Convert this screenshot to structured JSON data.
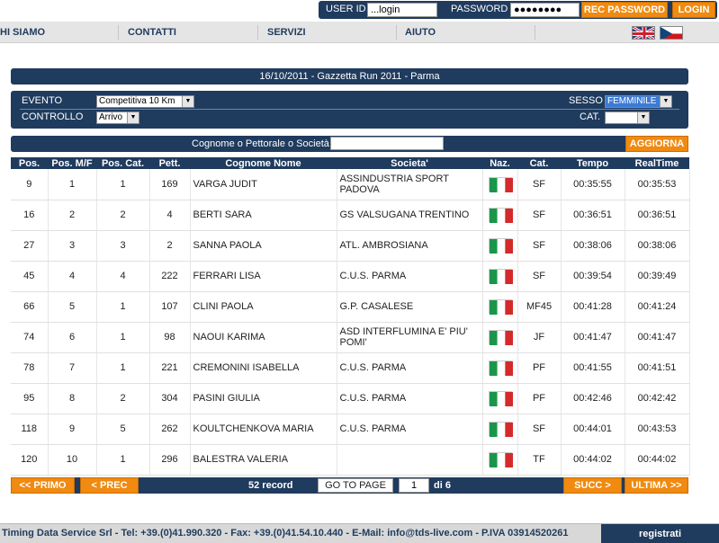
{
  "login": {
    "userid_label": "USER ID",
    "userid_value": "...login",
    "password_label": "PASSWORD",
    "password_value": "●●●●●●●●",
    "recpassword_label": "REC PASSWORD",
    "login_label": "LOGIN"
  },
  "nav": {
    "items": [
      "HI SIAMO",
      "CONTATTI",
      "SERVIZI",
      "AIUTO"
    ],
    "flags": [
      "uk-flag-icon",
      "cz-flag-icon"
    ]
  },
  "event_title": "16/10/2011 - Gazzetta Run 2011 - Parma",
  "filters": {
    "evento_label": "EVENTO",
    "evento_value": "Competitiva 10 Km",
    "controllo_label": "CONTROLLO",
    "controllo_value": "Arrivo",
    "sesso_label": "SESSO",
    "sesso_value": "FEMMINILE",
    "cat_label": "CAT.",
    "cat_value": ""
  },
  "search": {
    "label": "Cognome o Pettorale o Società",
    "value": "",
    "button": "AGGIORNA"
  },
  "table": {
    "columns": [
      "Pos.",
      "Pos. M/F",
      "Pos. Cat.",
      "Pett.",
      "Cognome Nome",
      "Societa'",
      "Naz.",
      "Cat.",
      "Tempo",
      "RealTime"
    ],
    "rows": [
      [
        "9",
        "1",
        "1",
        "169",
        "VARGA JUDIT",
        "ASSINDUSTRIA SPORT PADOVA",
        "ITA",
        "SF",
        "00:35:55",
        "00:35:53"
      ],
      [
        "16",
        "2",
        "2",
        "4",
        "BERTI SARA",
        "GS VALSUGANA TRENTINO",
        "ITA",
        "SF",
        "00:36:51",
        "00:36:51"
      ],
      [
        "27",
        "3",
        "3",
        "2",
        "SANNA PAOLA",
        "ATL. AMBROSIANA",
        "ITA",
        "SF",
        "00:38:06",
        "00:38:06"
      ],
      [
        "45",
        "4",
        "4",
        "222",
        "FERRARI LISA",
        "C.U.S. PARMA",
        "ITA",
        "SF",
        "00:39:54",
        "00:39:49"
      ],
      [
        "66",
        "5",
        "1",
        "107",
        "CLINI PAOLA",
        "G.P. CASALESE",
        "ITA",
        "MF45",
        "00:41:28",
        "00:41:24"
      ],
      [
        "74",
        "6",
        "1",
        "98",
        "NAOUI KARIMA",
        "ASD INTERFLUMINA E' PIU' POMI'",
        "ITA",
        "JF",
        "00:41:47",
        "00:41:47"
      ],
      [
        "78",
        "7",
        "1",
        "221",
        "CREMONINI ISABELLA",
        "C.U.S. PARMA",
        "ITA",
        "PF",
        "00:41:55",
        "00:41:51"
      ],
      [
        "95",
        "8",
        "2",
        "304",
        "PASINI GIULIA",
        "C.U.S. PARMA",
        "ITA",
        "PF",
        "00:42:46",
        "00:42:42"
      ],
      [
        "118",
        "9",
        "5",
        "262",
        "KOULTCHENKOVA MARIA",
        "C.U.S. PARMA",
        "ITA",
        "SF",
        "00:44:01",
        "00:43:53"
      ],
      [
        "120",
        "10",
        "1",
        "296",
        "BALESTRA VALERIA",
        "",
        "ITA",
        "TF",
        "00:44:02",
        "00:44:02"
      ]
    ]
  },
  "pager": {
    "first": "<< PRIMO",
    "prev": "< PREC",
    "records": "52 record",
    "goto": "GO TO PAGE",
    "page": "1",
    "of": "di 6",
    "next": "SUCC >",
    "last": "ULTIMA >>"
  },
  "footer": {
    "text": "Timing Data Service Srl - Tel: +39.(0)41.990.320 - Fax: +39.(0)41.54.10.440 - E-Mail: info@tds-live.com - P.IVA 03914520261",
    "register": "registrati"
  },
  "colors": {
    "navy": "#1f3b5e",
    "orange": "#f08a10"
  }
}
